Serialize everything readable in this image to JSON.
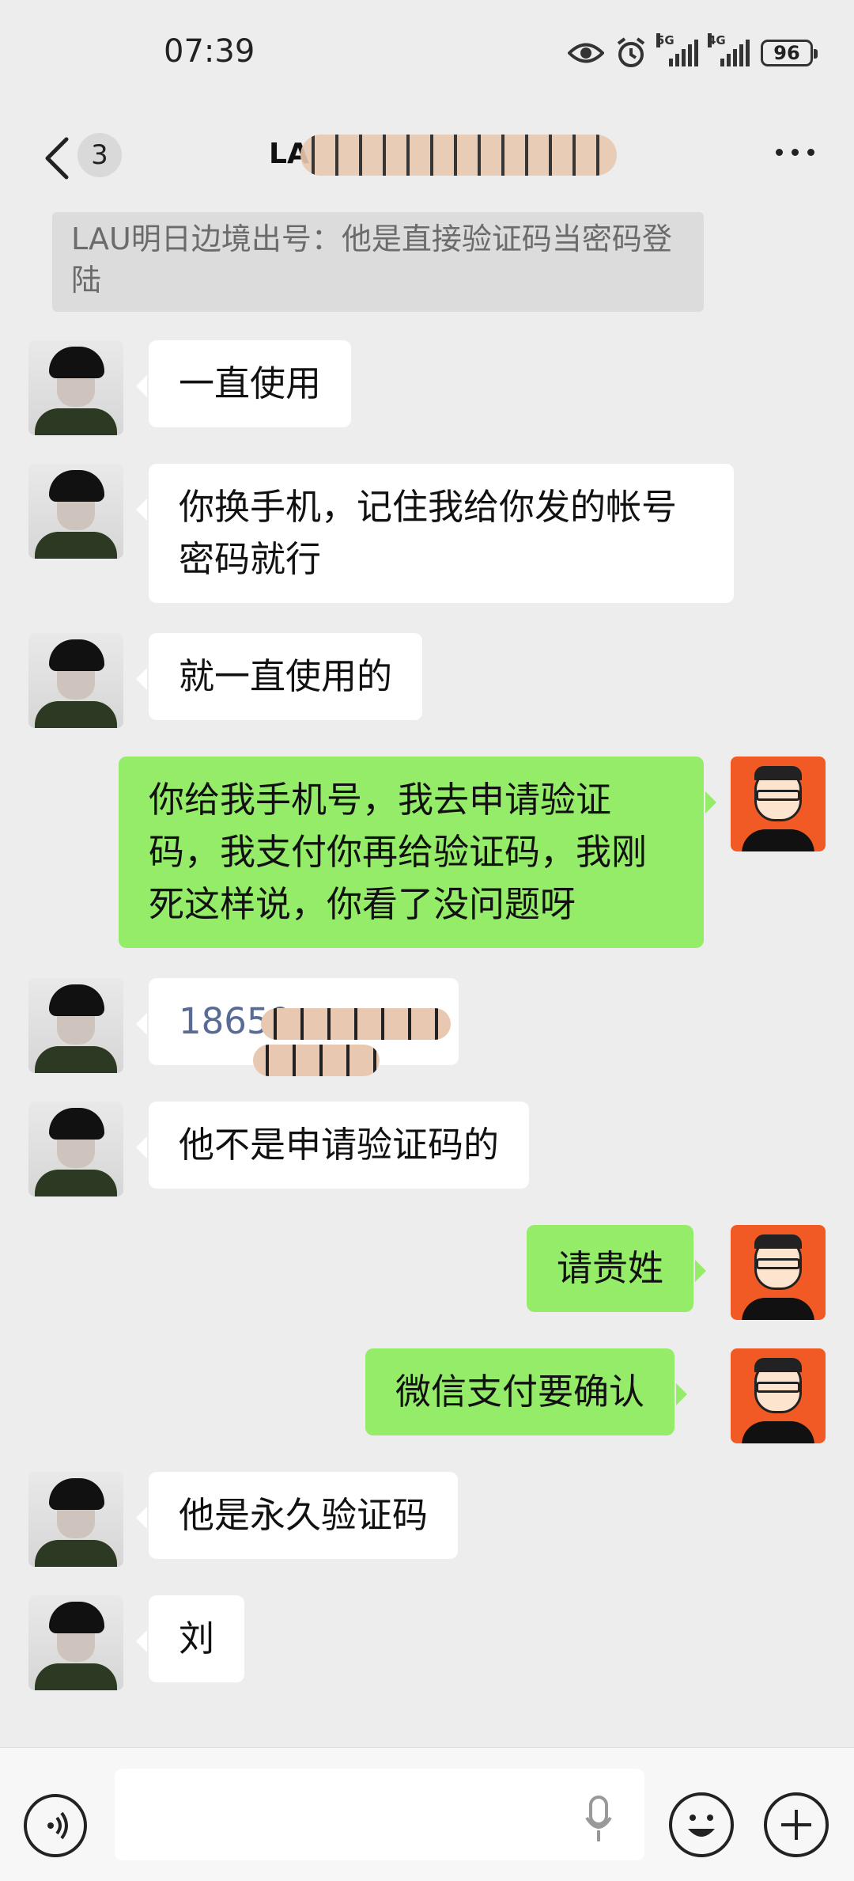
{
  "status": {
    "time": "07:39",
    "net1": "5G",
    "net2": "4G",
    "battery": "96",
    "icons": [
      "eye-icon",
      "alarm-icon",
      "signal-5g-icon",
      "signal-4g-icon",
      "battery-icon"
    ]
  },
  "header": {
    "back_icon": "chevron-left-icon",
    "unread_count": "3",
    "title_visible": "LA",
    "more_icon": "ellipsis-icon"
  },
  "quote": {
    "text": "LAU明日边境出号：他是直接验证码当密码登陆"
  },
  "messages": [
    {
      "side": "in",
      "text": "一直使用"
    },
    {
      "side": "in",
      "text": "你换手机，记住我给你发的帐号密码就行"
    },
    {
      "side": "in",
      "text": "就一直使用的"
    },
    {
      "side": "out",
      "text": "你给我手机号，我去申请验证码，我支付你再给验证码，我刚死这样说，你看了没问题呀"
    },
    {
      "side": "in",
      "text": "18659"
    },
    {
      "side": "in",
      "text": "他不是申请验证码的"
    },
    {
      "side": "out",
      "text": "请贵姓"
    },
    {
      "side": "out",
      "text": "微信支付要确认"
    },
    {
      "side": "in",
      "text": "他是永久验证码"
    },
    {
      "side": "in",
      "text": "刘"
    }
  ],
  "input": {
    "value": "",
    "icons": [
      "voice-icon",
      "mic-icon",
      "emoji-icon",
      "plus-icon"
    ]
  },
  "colors": {
    "background": "#ededed",
    "incoming_bubble": "#ffffff",
    "outgoing_bubble": "#95ec69",
    "link": "#576b95"
  }
}
